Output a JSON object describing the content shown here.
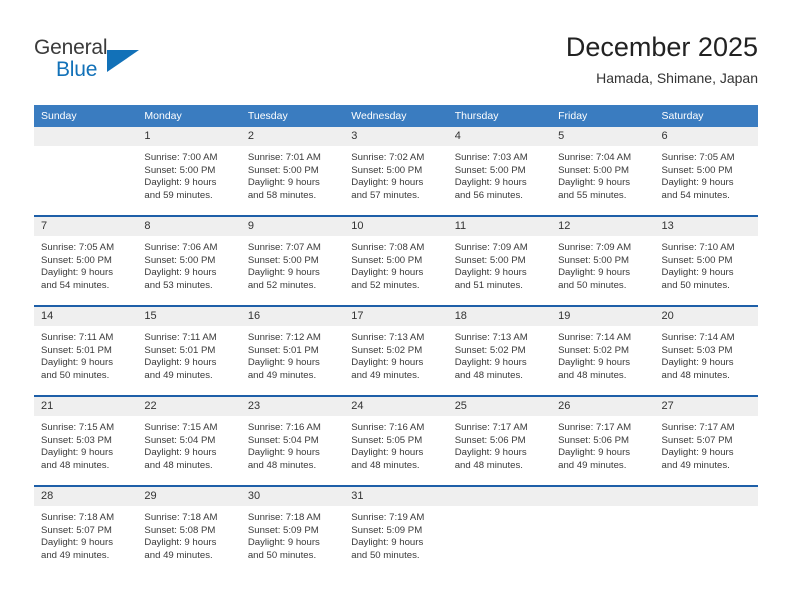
{
  "brand": {
    "name_part1": "General",
    "name_part2": "Blue",
    "logo_icon": "triangle-logo-icon",
    "accent_color": "#1271b8"
  },
  "header": {
    "title": "December 2025",
    "subtitle": "Hamada, Shimane, Japan"
  },
  "theme": {
    "header_row_bg": "#3a7cc0",
    "week_separator": "#1e5fa8",
    "daynum_band_bg": "#efefef"
  },
  "calendar": {
    "weekday_headers": [
      "Sunday",
      "Monday",
      "Tuesday",
      "Wednesday",
      "Thursday",
      "Friday",
      "Saturday"
    ],
    "weeks": [
      [
        {
          "day": "",
          "empty": true,
          "sunrise": "",
          "sunset": "",
          "daylight_line1": "",
          "daylight_line2": ""
        },
        {
          "day": "1",
          "empty": false,
          "sunrise": "Sunrise: 7:00 AM",
          "sunset": "Sunset: 5:00 PM",
          "daylight_line1": "Daylight: 9 hours",
          "daylight_line2": "and 59 minutes."
        },
        {
          "day": "2",
          "empty": false,
          "sunrise": "Sunrise: 7:01 AM",
          "sunset": "Sunset: 5:00 PM",
          "daylight_line1": "Daylight: 9 hours",
          "daylight_line2": "and 58 minutes."
        },
        {
          "day": "3",
          "empty": false,
          "sunrise": "Sunrise: 7:02 AM",
          "sunset": "Sunset: 5:00 PM",
          "daylight_line1": "Daylight: 9 hours",
          "daylight_line2": "and 57 minutes."
        },
        {
          "day": "4",
          "empty": false,
          "sunrise": "Sunrise: 7:03 AM",
          "sunset": "Sunset: 5:00 PM",
          "daylight_line1": "Daylight: 9 hours",
          "daylight_line2": "and 56 minutes."
        },
        {
          "day": "5",
          "empty": false,
          "sunrise": "Sunrise: 7:04 AM",
          "sunset": "Sunset: 5:00 PM",
          "daylight_line1": "Daylight: 9 hours",
          "daylight_line2": "and 55 minutes."
        },
        {
          "day": "6",
          "empty": false,
          "sunrise": "Sunrise: 7:05 AM",
          "sunset": "Sunset: 5:00 PM",
          "daylight_line1": "Daylight: 9 hours",
          "daylight_line2": "and 54 minutes."
        }
      ],
      [
        {
          "day": "7",
          "empty": false,
          "sunrise": "Sunrise: 7:05 AM",
          "sunset": "Sunset: 5:00 PM",
          "daylight_line1": "Daylight: 9 hours",
          "daylight_line2": "and 54 minutes."
        },
        {
          "day": "8",
          "empty": false,
          "sunrise": "Sunrise: 7:06 AM",
          "sunset": "Sunset: 5:00 PM",
          "daylight_line1": "Daylight: 9 hours",
          "daylight_line2": "and 53 minutes."
        },
        {
          "day": "9",
          "empty": false,
          "sunrise": "Sunrise: 7:07 AM",
          "sunset": "Sunset: 5:00 PM",
          "daylight_line1": "Daylight: 9 hours",
          "daylight_line2": "and 52 minutes."
        },
        {
          "day": "10",
          "empty": false,
          "sunrise": "Sunrise: 7:08 AM",
          "sunset": "Sunset: 5:00 PM",
          "daylight_line1": "Daylight: 9 hours",
          "daylight_line2": "and 52 minutes."
        },
        {
          "day": "11",
          "empty": false,
          "sunrise": "Sunrise: 7:09 AM",
          "sunset": "Sunset: 5:00 PM",
          "daylight_line1": "Daylight: 9 hours",
          "daylight_line2": "and 51 minutes."
        },
        {
          "day": "12",
          "empty": false,
          "sunrise": "Sunrise: 7:09 AM",
          "sunset": "Sunset: 5:00 PM",
          "daylight_line1": "Daylight: 9 hours",
          "daylight_line2": "and 50 minutes."
        },
        {
          "day": "13",
          "empty": false,
          "sunrise": "Sunrise: 7:10 AM",
          "sunset": "Sunset: 5:00 PM",
          "daylight_line1": "Daylight: 9 hours",
          "daylight_line2": "and 50 minutes."
        }
      ],
      [
        {
          "day": "14",
          "empty": false,
          "sunrise": "Sunrise: 7:11 AM",
          "sunset": "Sunset: 5:01 PM",
          "daylight_line1": "Daylight: 9 hours",
          "daylight_line2": "and 50 minutes."
        },
        {
          "day": "15",
          "empty": false,
          "sunrise": "Sunrise: 7:11 AM",
          "sunset": "Sunset: 5:01 PM",
          "daylight_line1": "Daylight: 9 hours",
          "daylight_line2": "and 49 minutes."
        },
        {
          "day": "16",
          "empty": false,
          "sunrise": "Sunrise: 7:12 AM",
          "sunset": "Sunset: 5:01 PM",
          "daylight_line1": "Daylight: 9 hours",
          "daylight_line2": "and 49 minutes."
        },
        {
          "day": "17",
          "empty": false,
          "sunrise": "Sunrise: 7:13 AM",
          "sunset": "Sunset: 5:02 PM",
          "daylight_line1": "Daylight: 9 hours",
          "daylight_line2": "and 49 minutes."
        },
        {
          "day": "18",
          "empty": false,
          "sunrise": "Sunrise: 7:13 AM",
          "sunset": "Sunset: 5:02 PM",
          "daylight_line1": "Daylight: 9 hours",
          "daylight_line2": "and 48 minutes."
        },
        {
          "day": "19",
          "empty": false,
          "sunrise": "Sunrise: 7:14 AM",
          "sunset": "Sunset: 5:02 PM",
          "daylight_line1": "Daylight: 9 hours",
          "daylight_line2": "and 48 minutes."
        },
        {
          "day": "20",
          "empty": false,
          "sunrise": "Sunrise: 7:14 AM",
          "sunset": "Sunset: 5:03 PM",
          "daylight_line1": "Daylight: 9 hours",
          "daylight_line2": "and 48 minutes."
        }
      ],
      [
        {
          "day": "21",
          "empty": false,
          "sunrise": "Sunrise: 7:15 AM",
          "sunset": "Sunset: 5:03 PM",
          "daylight_line1": "Daylight: 9 hours",
          "daylight_line2": "and 48 minutes."
        },
        {
          "day": "22",
          "empty": false,
          "sunrise": "Sunrise: 7:15 AM",
          "sunset": "Sunset: 5:04 PM",
          "daylight_line1": "Daylight: 9 hours",
          "daylight_line2": "and 48 minutes."
        },
        {
          "day": "23",
          "empty": false,
          "sunrise": "Sunrise: 7:16 AM",
          "sunset": "Sunset: 5:04 PM",
          "daylight_line1": "Daylight: 9 hours",
          "daylight_line2": "and 48 minutes."
        },
        {
          "day": "24",
          "empty": false,
          "sunrise": "Sunrise: 7:16 AM",
          "sunset": "Sunset: 5:05 PM",
          "daylight_line1": "Daylight: 9 hours",
          "daylight_line2": "and 48 minutes."
        },
        {
          "day": "25",
          "empty": false,
          "sunrise": "Sunrise: 7:17 AM",
          "sunset": "Sunset: 5:06 PM",
          "daylight_line1": "Daylight: 9 hours",
          "daylight_line2": "and 48 minutes."
        },
        {
          "day": "26",
          "empty": false,
          "sunrise": "Sunrise: 7:17 AM",
          "sunset": "Sunset: 5:06 PM",
          "daylight_line1": "Daylight: 9 hours",
          "daylight_line2": "and 49 minutes."
        },
        {
          "day": "27",
          "empty": false,
          "sunrise": "Sunrise: 7:17 AM",
          "sunset": "Sunset: 5:07 PM",
          "daylight_line1": "Daylight: 9 hours",
          "daylight_line2": "and 49 minutes."
        }
      ],
      [
        {
          "day": "28",
          "empty": false,
          "sunrise": "Sunrise: 7:18 AM",
          "sunset": "Sunset: 5:07 PM",
          "daylight_line1": "Daylight: 9 hours",
          "daylight_line2": "and 49 minutes."
        },
        {
          "day": "29",
          "empty": false,
          "sunrise": "Sunrise: 7:18 AM",
          "sunset": "Sunset: 5:08 PM",
          "daylight_line1": "Daylight: 9 hours",
          "daylight_line2": "and 49 minutes."
        },
        {
          "day": "30",
          "empty": false,
          "sunrise": "Sunrise: 7:18 AM",
          "sunset": "Sunset: 5:09 PM",
          "daylight_line1": "Daylight: 9 hours",
          "daylight_line2": "and 50 minutes."
        },
        {
          "day": "31",
          "empty": false,
          "sunrise": "Sunrise: 7:19 AM",
          "sunset": "Sunset: 5:09 PM",
          "daylight_line1": "Daylight: 9 hours",
          "daylight_line2": "and 50 minutes."
        },
        {
          "day": "",
          "empty": true,
          "sunrise": "",
          "sunset": "",
          "daylight_line1": "",
          "daylight_line2": ""
        },
        {
          "day": "",
          "empty": true,
          "sunrise": "",
          "sunset": "",
          "daylight_line1": "",
          "daylight_line2": ""
        },
        {
          "day": "",
          "empty": true,
          "sunrise": "",
          "sunset": "",
          "daylight_line1": "",
          "daylight_line2": ""
        }
      ]
    ]
  }
}
